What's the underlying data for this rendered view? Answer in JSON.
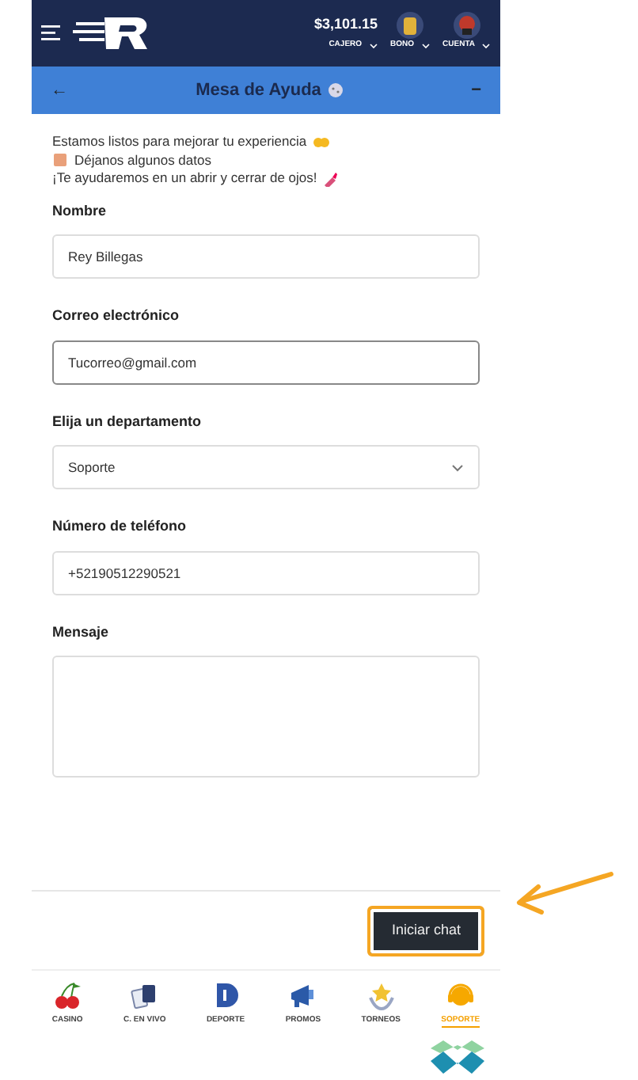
{
  "header": {
    "balance": "$3,101.15",
    "menus": [
      {
        "label": "CAJERO"
      },
      {
        "label": "BONO"
      },
      {
        "label": "CUENTA"
      }
    ]
  },
  "title_bar": {
    "back": "←",
    "title": "Mesa de Ayuda",
    "minimize": "−"
  },
  "intro": [
    "Estamos listos para mejorar tu experiencia",
    "Déjanos algunos datos",
    "¡Te ayudaremos en un abrir y cerrar de ojos!"
  ],
  "fields": [
    {
      "label": "Nombre",
      "kind": "text",
      "value": "Rey Billegas",
      "focused": false
    },
    {
      "label": "Correo electrónico",
      "kind": "text",
      "value": "Tucorreo@gmail.com",
      "focused": true
    },
    {
      "label": "Elija un departamento",
      "kind": "select",
      "value": "Soporte",
      "focused": false
    },
    {
      "label": "Número de teléfono",
      "kind": "text",
      "value": "+52190512290521",
      "focused": false
    },
    {
      "label": "Mensaje",
      "kind": "textarea",
      "focused": false
    }
  ],
  "submit": {
    "label": "Iniciar chat",
    "highlighted": true
  },
  "nav": [
    {
      "label": "CASINO",
      "kind": "cherries",
      "selected": false
    },
    {
      "label": "C. EN VIVO",
      "kind": "cards",
      "selected": false
    },
    {
      "label": "DEPORTE",
      "kind": "sports",
      "selected": false
    },
    {
      "label": "PROMOS",
      "kind": "megaphone",
      "selected": false
    },
    {
      "label": "TORNEOS",
      "kind": "trophy",
      "selected": false
    },
    {
      "label": "SOPORTE",
      "kind": "headset",
      "selected": true
    }
  ]
}
